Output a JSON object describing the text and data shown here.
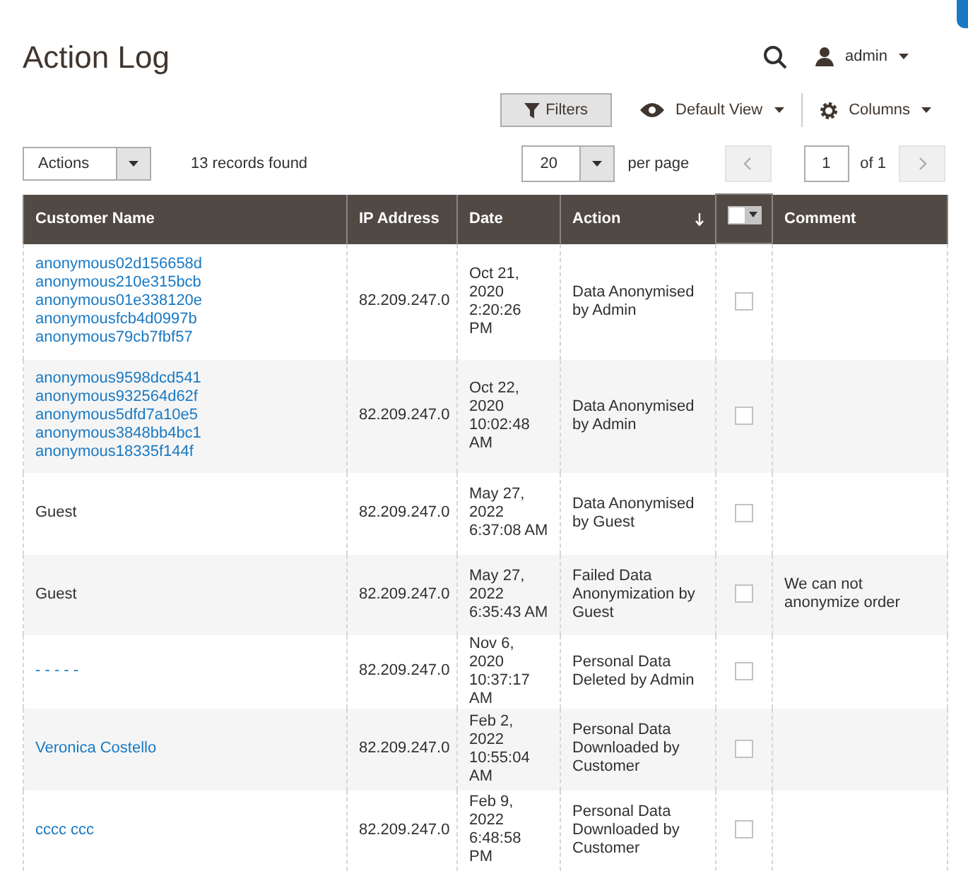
{
  "page_title": "Action Log",
  "header": {
    "user": "admin"
  },
  "toolbar": {
    "filters": "Filters",
    "view": "Default View",
    "columns": "Columns"
  },
  "grid_controls": {
    "actions": "Actions",
    "records": "13 records found",
    "per_page_value": "20",
    "per_page_label": "per page",
    "page": "1",
    "page_total": "of 1"
  },
  "table": {
    "columns": [
      {
        "kind": "text",
        "label": "Customer Name",
        "sorted": false
      },
      {
        "kind": "text",
        "label": "IP Address",
        "sorted": false
      },
      {
        "kind": "text",
        "label": "Date",
        "sorted": false
      },
      {
        "kind": "text",
        "label": "Action",
        "sorted": true
      },
      {
        "kind": "mass-select",
        "checked": false
      },
      {
        "kind": "text",
        "label": "Comment",
        "sorted": false
      }
    ],
    "rows": [
      {
        "customers": [
          {
            "text": "anonymous02d156658d",
            "link": true
          },
          {
            "text": "anonymous210e315bcb",
            "link": true
          },
          {
            "text": "anonymous01e338120e",
            "link": true
          },
          {
            "text": "anonymousfcb4d0997b",
            "link": true
          },
          {
            "text": "anonymous79cb7fbf57",
            "link": true
          }
        ],
        "ip": "82.209.247.0",
        "date": "Oct 21, 2020 2:20:26 PM",
        "action": "Data Anonymised by Admin",
        "checked": false
      },
      {
        "customers": [
          {
            "text": "anonymous9598dcd541",
            "link": true
          },
          {
            "text": "anonymous932564d62f",
            "link": true
          },
          {
            "text": "anonymous5dfd7a10e5",
            "link": true
          },
          {
            "text": "anonymous3848bb4bc1",
            "link": true
          },
          {
            "text": "anonymous18335f144f",
            "link": true
          }
        ],
        "ip": "82.209.247.0",
        "date": "Oct 22, 2020 10:02:48 AM",
        "action": "Data Anonymised by Admin",
        "checked": false
      },
      {
        "customers": [
          {
            "text": "Guest",
            "link": false
          }
        ],
        "ip": "82.209.247.0",
        "date": "May 27, 2022 6:37:08 AM",
        "action": "Data Anonymised by Guest",
        "checked": false
      },
      {
        "customers": [
          {
            "text": "Guest",
            "link": false
          }
        ],
        "ip": "82.209.247.0",
        "date": "May 27, 2022 6:35:43 AM",
        "action": "Failed Data Anonymization by Guest",
        "checked": false,
        "comment": "We can not anonymize order"
      },
      {
        "customers": [
          {
            "text": "- - - - -",
            "link": true
          }
        ],
        "ip": "82.209.247.0",
        "date": "Nov 6, 2020 10:37:17 AM",
        "action": "Personal Data Deleted by Admin",
        "checked": false
      },
      {
        "customers": [
          {
            "text": "Veronica Costello",
            "link": true
          }
        ],
        "ip": "82.209.247.0",
        "date": "Feb 2, 2022 10:55:04 AM",
        "action": "Personal Data Downloaded by Customer",
        "checked": false
      },
      {
        "customers": [
          {
            "text": "cccc ccc",
            "link": true
          }
        ],
        "ip": "82.209.247.0",
        "date": "Feb 9, 2022 6:48:58 PM",
        "action": "Personal Data Downloaded by Customer",
        "checked": false
      }
    ]
  }
}
